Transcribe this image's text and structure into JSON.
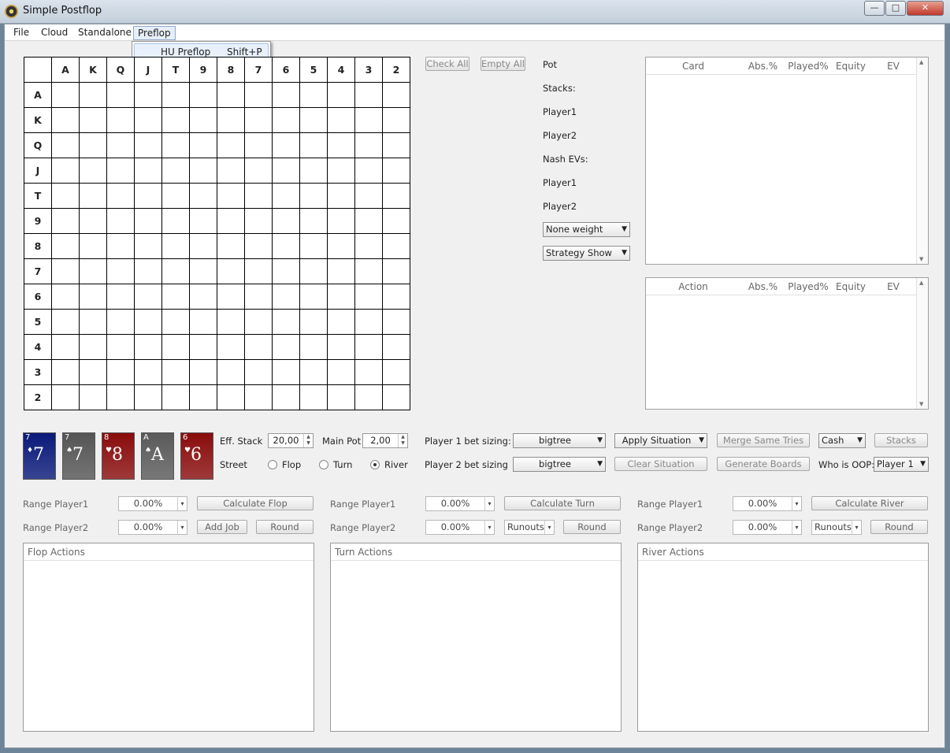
{
  "window": {
    "title": "Simple Postflop",
    "buttons": {
      "minimize": "—",
      "maximize": "□",
      "close": "✕"
    }
  },
  "menu": [
    {
      "label": "File"
    },
    {
      "label": "Cloud"
    },
    {
      "label": "Standalone"
    },
    {
      "label": "Preflop"
    }
  ],
  "dropdown": {
    "item": "HU Preflop",
    "shortcut": "Shift+P"
  },
  "ranks": [
    "A",
    "K",
    "Q",
    "J",
    "T",
    "9",
    "8",
    "7",
    "6",
    "5",
    "4",
    "3",
    "2"
  ],
  "grid_buttons": {
    "check_all": "Check All",
    "empty_all": "Empty All"
  },
  "info": {
    "pot": "Pot",
    "stacks": "Stacks:",
    "player1": "Player1",
    "player2": "Player2",
    "nash_evs": "Nash EVs:",
    "player1_b": "Player1",
    "player2_b": "Player2",
    "weight_combo": "None weight",
    "strategy_combo": "Strategy Show"
  },
  "card_table": {
    "headers": [
      "Card",
      "Abs.%",
      "Played%",
      "Equity",
      "EV"
    ]
  },
  "action_table": {
    "headers": [
      "Action",
      "Abs.%",
      "Played%",
      "Equity",
      "EV"
    ]
  },
  "cards": [
    {
      "rank": "7",
      "suit": "♦",
      "color": "#0a1a7a"
    },
    {
      "rank": "7",
      "suit": "♠",
      "color": "#555555"
    },
    {
      "rank": "8",
      "suit": "♥",
      "color": "#8a0c0c"
    },
    {
      "rank": "A",
      "suit": "♠",
      "color": "#5a5a5a"
    },
    {
      "rank": "6",
      "suit": "♥",
      "color": "#8a0c0c"
    }
  ],
  "controls": {
    "eff_stack_label": "Eff. Stack",
    "eff_stack": "20,00",
    "main_pot_label": "Main Pot",
    "main_pot": "2,00",
    "street_label": "Street",
    "flop": "Flop",
    "turn": "Turn",
    "river": "River",
    "p1_sizing_label": "Player 1 bet sizing:",
    "p1_sizing": "bigtree",
    "p2_sizing_label": "Player 2 bet sizing",
    "p2_sizing": "bigtree",
    "apply_situation": "Apply Situation",
    "clear_situation": "Clear Situation",
    "merge_same_tries": "Merge Same Tries",
    "generate_boards": "Generate Boards",
    "game_type": "Cash",
    "stacks_button": "Stacks",
    "oop_label": "Who is OOP:",
    "oop_value": "Player 1"
  },
  "flop": {
    "range1": "Range Player1",
    "range2": "Range Player2",
    "val1": "0.00%",
    "val2": "0.00%",
    "calc": "Calculate Flop",
    "add_job": "Add Job",
    "round": "Round",
    "title": "Flop Actions"
  },
  "turn": {
    "range1": "Range Player1",
    "range2": "Range Player2",
    "val1": "0.00%",
    "val2": "0.00%",
    "calc": "Calculate Turn",
    "runouts": "Runouts",
    "round": "Round",
    "title": "Turn Actions"
  },
  "river": {
    "range1": "Range Player1",
    "range2": "Range Player2",
    "val1": "0.00%",
    "val2": "0.00%",
    "calc": "Calculate River",
    "runouts": "Runouts",
    "round": "Round",
    "title": "River Actions"
  }
}
